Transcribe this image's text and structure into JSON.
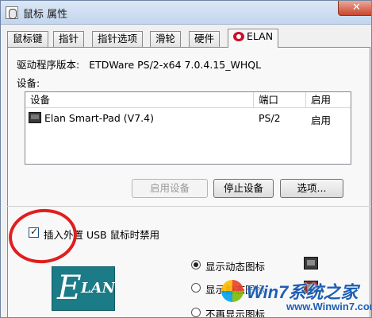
{
  "window": {
    "title": "鼠标 属性",
    "close_glyph": "✕"
  },
  "tabs": [
    {
      "label": "鼠标键"
    },
    {
      "label": "指针"
    },
    {
      "label": "指针选项"
    },
    {
      "label": "滑轮"
    },
    {
      "label": "硬件"
    },
    {
      "label": "ELAN",
      "active": true
    }
  ],
  "driver": {
    "label": "驱动程序版本:",
    "value": "ETDWare PS/2-x64 7.0.4.15_WHQL"
  },
  "devices": {
    "label": "设备:",
    "columns": [
      "设备",
      "端口",
      "启用"
    ],
    "rows": [
      {
        "name": "Elan Smart-Pad  (V7.4)",
        "port": "PS/2",
        "enabled": "启用",
        "icon": "touchpad-icon"
      }
    ]
  },
  "buttons": {
    "enable": "启用设备",
    "disable": "停止设备",
    "options": "选项..."
  },
  "disable_on_usb": {
    "label": "插入外置 USB 鼠标时禁用",
    "checked": true
  },
  "logo": {
    "brand_text": "LAN",
    "brand_initial": "E"
  },
  "tray_icon": {
    "options": [
      {
        "label": "显示动态图标",
        "selected": true,
        "icon": "touchpad-status-icon"
      },
      {
        "label": "显示静态图标",
        "selected": false,
        "icon": "touchpad-static-icon"
      },
      {
        "label": "不再显示图标",
        "selected": false
      }
    ]
  },
  "watermark": {
    "title": "Win7系统之家",
    "url": "www.Winwin7.com"
  },
  "annotation": {
    "color": "#e01e1e"
  }
}
